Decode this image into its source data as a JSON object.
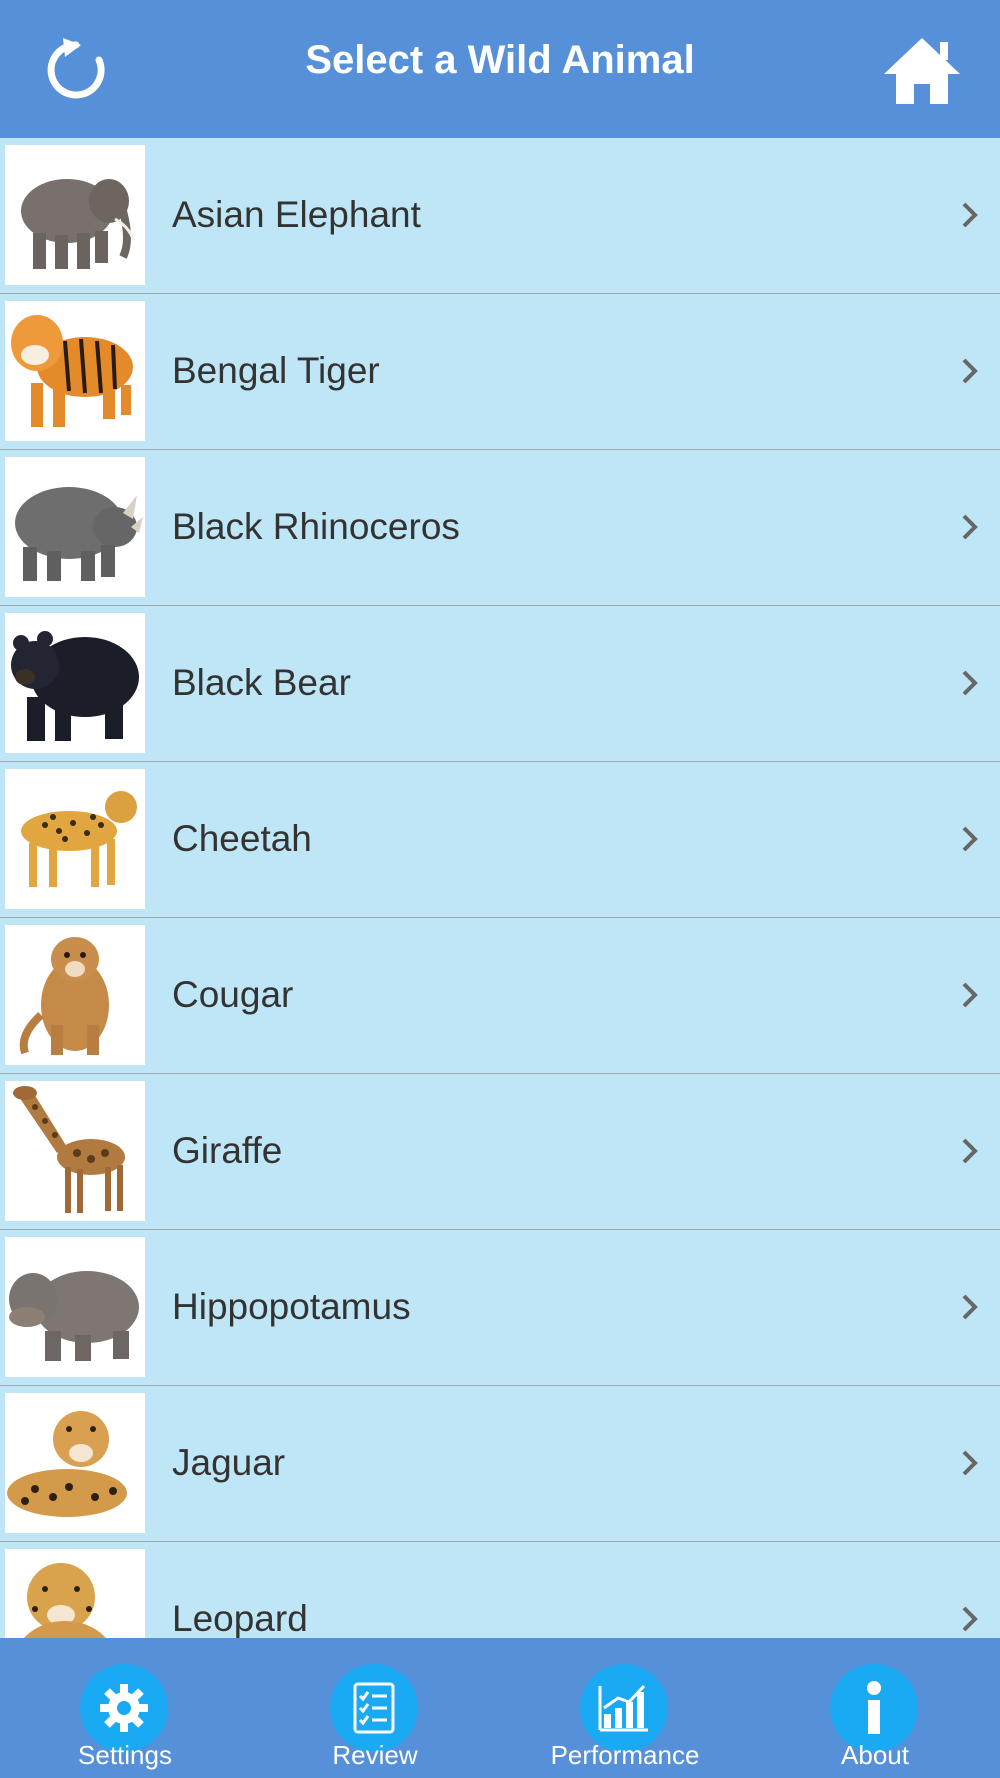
{
  "header": {
    "title": "Select a Wild Animal",
    "refresh_icon": "refresh-icon",
    "home_icon": "home-icon"
  },
  "list": {
    "items": [
      {
        "label": "Asian Elephant",
        "icon": "elephant-image"
      },
      {
        "label": "Bengal Tiger",
        "icon": "tiger-image"
      },
      {
        "label": "Black Rhinoceros",
        "icon": "rhinoceros-image"
      },
      {
        "label": "Black Bear",
        "icon": "bear-image"
      },
      {
        "label": "Cheetah",
        "icon": "cheetah-image"
      },
      {
        "label": "Cougar",
        "icon": "cougar-image"
      },
      {
        "label": "Giraffe",
        "icon": "giraffe-image"
      },
      {
        "label": "Hippopotamus",
        "icon": "hippopotamus-image"
      },
      {
        "label": "Jaguar",
        "icon": "jaguar-image"
      },
      {
        "label": "Leopard",
        "icon": "leopard-image"
      }
    ]
  },
  "tabbar": {
    "tabs": [
      {
        "label": "Settings",
        "icon": "gear-icon"
      },
      {
        "label": "Review",
        "icon": "checklist-icon"
      },
      {
        "label": "Performance",
        "icon": "bar-chart-icon"
      },
      {
        "label": "About",
        "icon": "info-icon"
      }
    ]
  },
  "colors": {
    "header_bg": "#5690d8",
    "row_bg": "#bfe6f6",
    "tab_circle": "#1aa9f3",
    "text": "#333333"
  }
}
